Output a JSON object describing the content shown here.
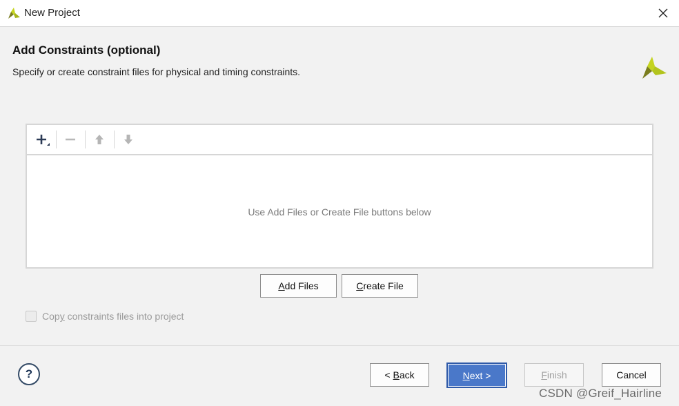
{
  "window": {
    "title": "New Project",
    "close_icon": "close-icon",
    "app_icon": "vivado-logo-icon"
  },
  "header": {
    "title": "Add Constraints (optional)",
    "subtitle": "Specify or create constraint files for physical and timing constraints."
  },
  "toolbar": {
    "icons": [
      "add-icon",
      "remove-icon",
      "move-up-icon",
      "move-down-icon"
    ]
  },
  "file_list": {
    "empty_message": "Use Add Files or Create File buttons below"
  },
  "actions": {
    "add_files_mnemonic": "A",
    "add_files_rest": "dd Files",
    "create_file_mnemonic": "C",
    "create_file_rest": "reate File"
  },
  "options": {
    "copy_into_project_checked": false,
    "copy_into_project_enabled": false,
    "copy_label_pre": "Cop",
    "copy_label_mnemonic": "y",
    "copy_label_post": " constraints files into project"
  },
  "footer": {
    "help": "?",
    "back_pre": "< ",
    "back_mnemonic": "B",
    "back_post": "ack",
    "next_mnemonic": "N",
    "next_post": "ext >",
    "finish_mnemonic": "F",
    "finish_post": "inish",
    "cancel": "Cancel"
  },
  "colors": {
    "accent_logo_yellow": "#c4d41f",
    "accent_logo_olive": "#7a7d1e",
    "primary_button": "#4a78c9"
  },
  "watermark": "CSDN @Greif_Hairline"
}
